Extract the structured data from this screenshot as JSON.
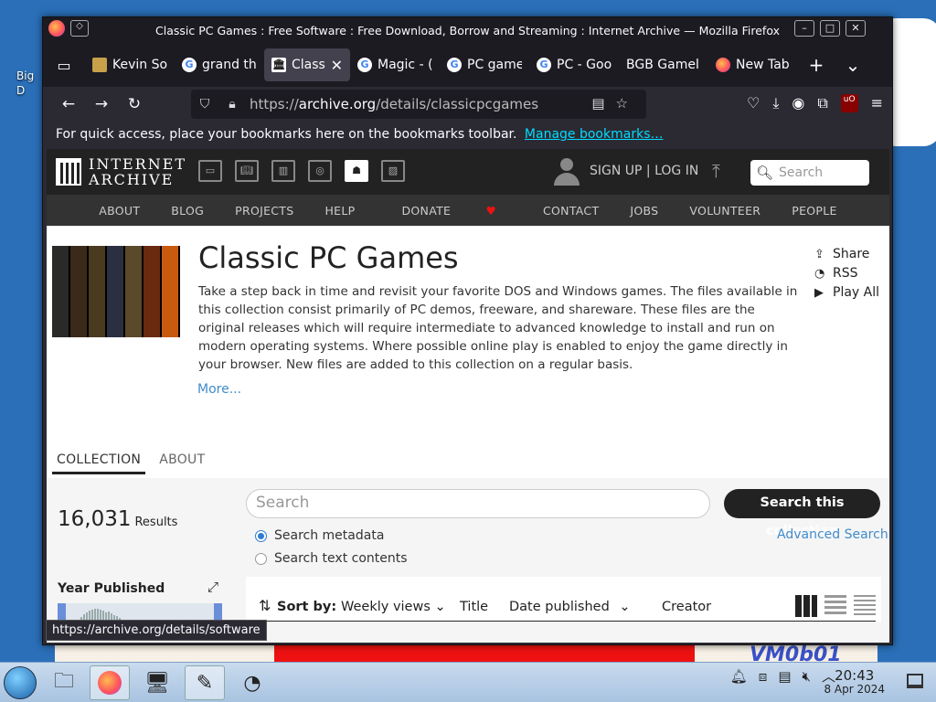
{
  "desktop": {
    "icon_label": "Big\nD",
    "watermark": "VM0b01"
  },
  "window": {
    "title": "Classic PC Games : Free Software : Free Download, Borrow and Streaming : Internet Archive — Mozilla Firefox"
  },
  "tabs": [
    {
      "label": "Kevin So",
      "favicon": "kv"
    },
    {
      "label": "grand th",
      "favicon": "g"
    },
    {
      "label": "Classi",
      "favicon": "ia",
      "active": true
    },
    {
      "label": "Magic - (",
      "favicon": "g"
    },
    {
      "label": "PC game",
      "favicon": "g"
    },
    {
      "label": "PC - Goo",
      "favicon": "g"
    },
    {
      "label": "BGB Gamel",
      "favicon": ""
    },
    {
      "label": "New Tab",
      "favicon": "ff"
    }
  ],
  "urlbar": {
    "prefix": "https://",
    "host": "archive.org",
    "path": "/details/classicpcgames"
  },
  "bookmarks": {
    "text": "For quick access, place your bookmarks here on the bookmarks toolbar.",
    "link": "Manage bookmarks…"
  },
  "ia": {
    "logo_line1": "INTERNET",
    "logo_line2": "ARCHIVE",
    "signup": "SIGN UP | LOG IN",
    "search_placeholder": "Search",
    "subnav": [
      "ABOUT",
      "BLOG",
      "PROJECTS",
      "HELP",
      "DONATE",
      "CONTACT",
      "JOBS",
      "VOLUNTEER",
      "PEOPLE"
    ]
  },
  "collection": {
    "title": "Classic PC Games",
    "description": "Take a step back in time and revisit your favorite DOS and Windows games. The files available in this collection consist primarily of PC demos, freeware, and shareware. These files are the original releases which will require intermediate to advanced knowledge to install and run on modern operating systems. Where possible online play is enabled to enjoy the game directly in your browser. New files are added to this collection on a regular basis.",
    "more": "More...",
    "share": "Share",
    "rss": "RSS",
    "play_all": "Play All",
    "tab_collection": "COLLECTION",
    "tab_about": "ABOUT",
    "results_count": "16,031",
    "results_label": "Results",
    "search_placeholder": "Search",
    "search_button": "Search this collection",
    "radio_metadata": "Search metadata",
    "radio_text": "Search text contents",
    "advanced": "Advanced Search",
    "year_published": "Year Published",
    "sort_label": "Sort by:",
    "sort_weekly": "Weekly views",
    "sort_title": "Title",
    "sort_date": "Date published",
    "sort_creator": "Creator"
  },
  "status_url": "https://archive.org/details/software",
  "clock": {
    "time": "20:43",
    "date": "8 Apr 2024"
  }
}
